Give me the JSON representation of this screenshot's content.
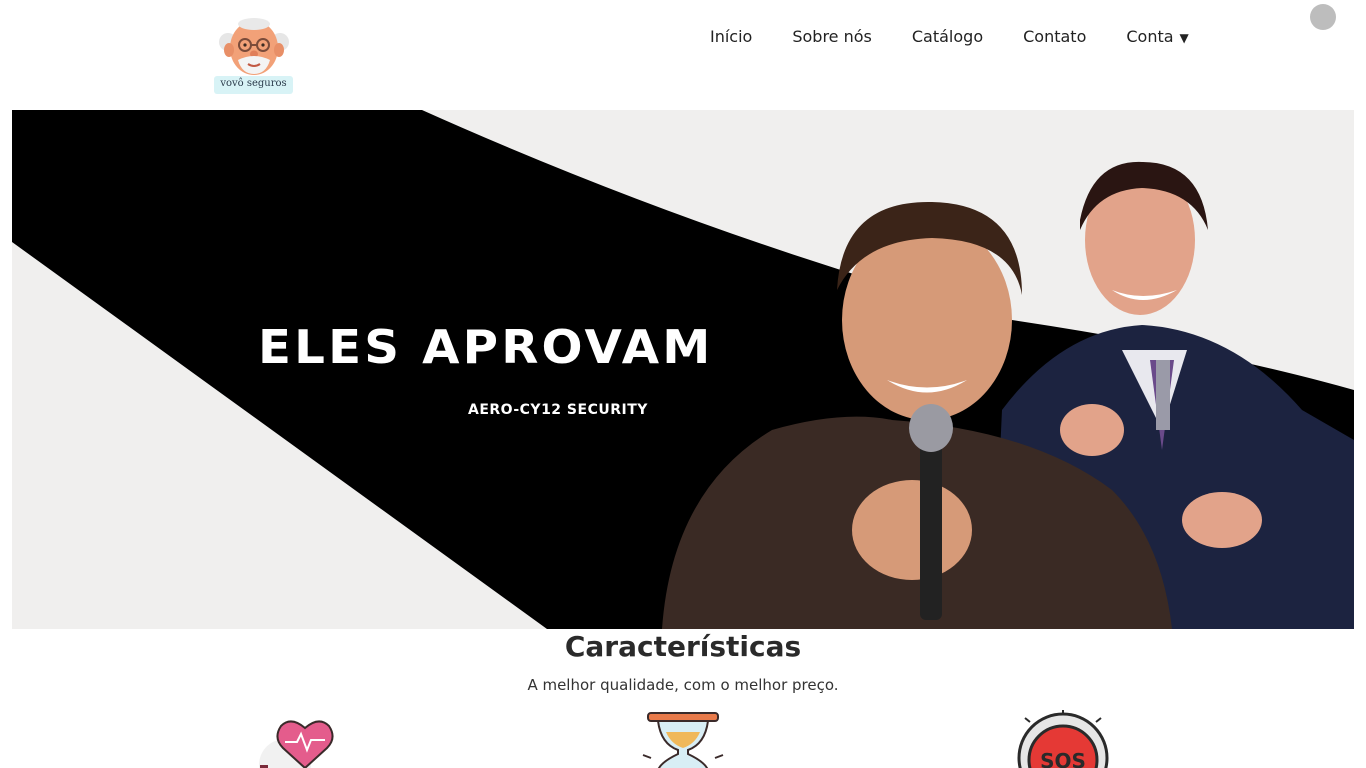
{
  "header": {
    "logo_text": "vovô seguros",
    "nav": [
      {
        "label": "Início"
      },
      {
        "label": "Sobre nós"
      },
      {
        "label": "Catálogo"
      },
      {
        "label": "Contato"
      },
      {
        "label": "Conta"
      }
    ],
    "account_caret": "▼"
  },
  "hero": {
    "title": "ELES APROVAM",
    "subtitle": "AERO-CY12 SECURITY"
  },
  "features": {
    "title": "Características",
    "subtitle": "A melhor qualidade, com o melhor preço.",
    "icons": [
      "heart-pulse-icon",
      "hourglass-icon",
      "sos-button-icon"
    ]
  },
  "colors": {
    "hero_bg": "#f0efee",
    "hero_band": "#000000",
    "heart": "#e45c8c",
    "sos": "#e53935"
  }
}
